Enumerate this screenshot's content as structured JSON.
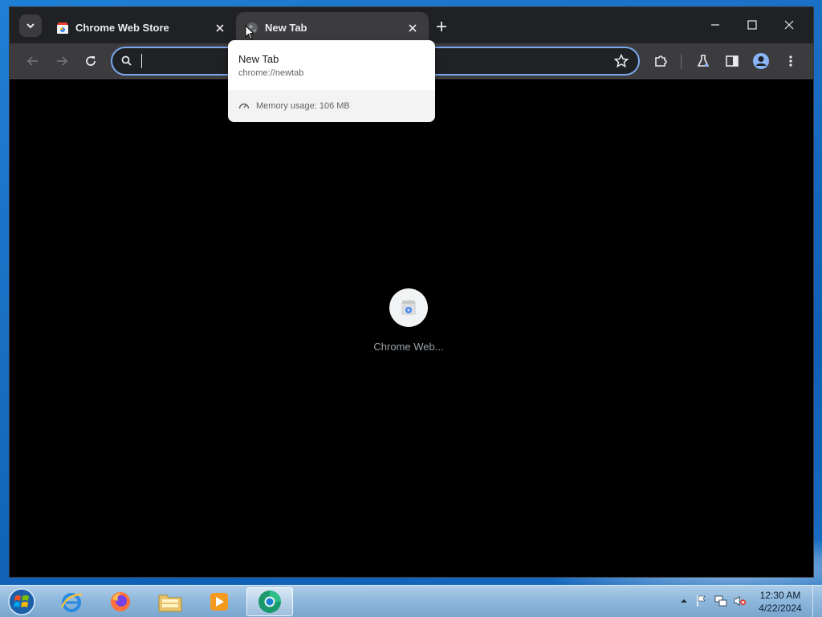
{
  "browser": {
    "tabs": [
      {
        "title": "Chrome Web Store",
        "active": false,
        "icon": "chrome-web-store-icon"
      },
      {
        "title": "New Tab",
        "active": true,
        "icon": "new-tab-globe-icon"
      }
    ],
    "omnibox": {
      "value": "",
      "placeholder": ""
    },
    "hover_card": {
      "title": "New Tab",
      "url": "chrome://newtab",
      "memory": "Memory usage: 106 MB"
    },
    "shortcuts": [
      {
        "label": "Chrome Web...",
        "icon": "chrome-web-store-icon"
      }
    ]
  },
  "taskbar": {
    "apps": [
      {
        "name": "Internet Explorer",
        "icon": "internet-explorer-icon",
        "active": false
      },
      {
        "name": "Firefox",
        "icon": "firefox-icon",
        "active": false
      },
      {
        "name": "Windows Explorer",
        "icon": "file-explorer-icon",
        "active": false
      },
      {
        "name": "Windows Media Player",
        "icon": "media-player-icon",
        "active": false
      },
      {
        "name": "Chrome",
        "icon": "chrome-icon",
        "active": true
      }
    ],
    "clock": {
      "time": "12:30 AM",
      "date": "4/22/2024"
    }
  },
  "colors": {
    "window_bg": "#202124",
    "toolbar_bg": "#3c3c3f",
    "omnibox_focus_border": "#7ca9f2",
    "content_bg": "#000000",
    "desktop_blue": "#1a6fc4"
  }
}
